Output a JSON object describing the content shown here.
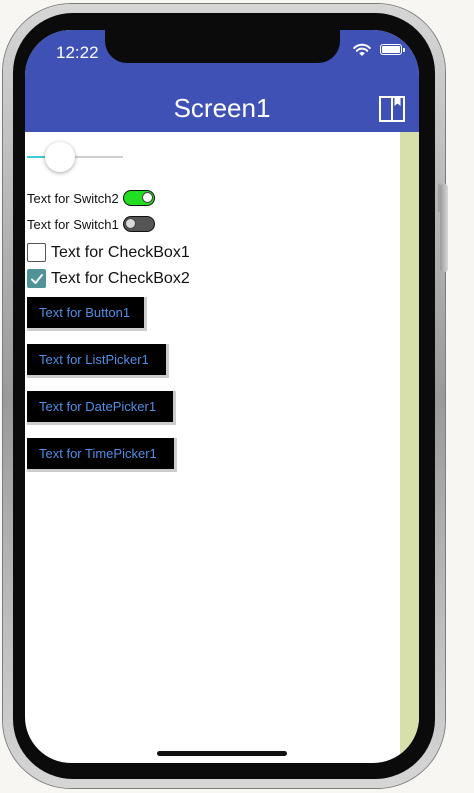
{
  "status_bar": {
    "time": "12:22",
    "wifi_icon": "wifi-icon",
    "battery_icon": "battery-icon"
  },
  "app_bar": {
    "title": "Screen1",
    "color": "#3f51b5",
    "action_icon": "book-icon"
  },
  "slider": {
    "value_fraction": 0.34,
    "active_color": "#40c9d6"
  },
  "switches": [
    {
      "label": "Text for Switch2",
      "on": true,
      "on_color": "#22dd22"
    },
    {
      "label": "Text for Switch1",
      "on": false
    }
  ],
  "checkboxes": [
    {
      "label": "Text for CheckBox1",
      "checked": false
    },
    {
      "label": "Text for CheckBox2",
      "checked": true,
      "check_color": "#4f9398"
    }
  ],
  "buttons": [
    {
      "label": "Text for Button1"
    },
    {
      "label": "Text for ListPicker1"
    },
    {
      "label": "Text for DatePicker1"
    },
    {
      "label": "Text for TimePicker1"
    }
  ],
  "button_text_color": "#4f8fe6",
  "side_panel_color": "#d7e0ab"
}
